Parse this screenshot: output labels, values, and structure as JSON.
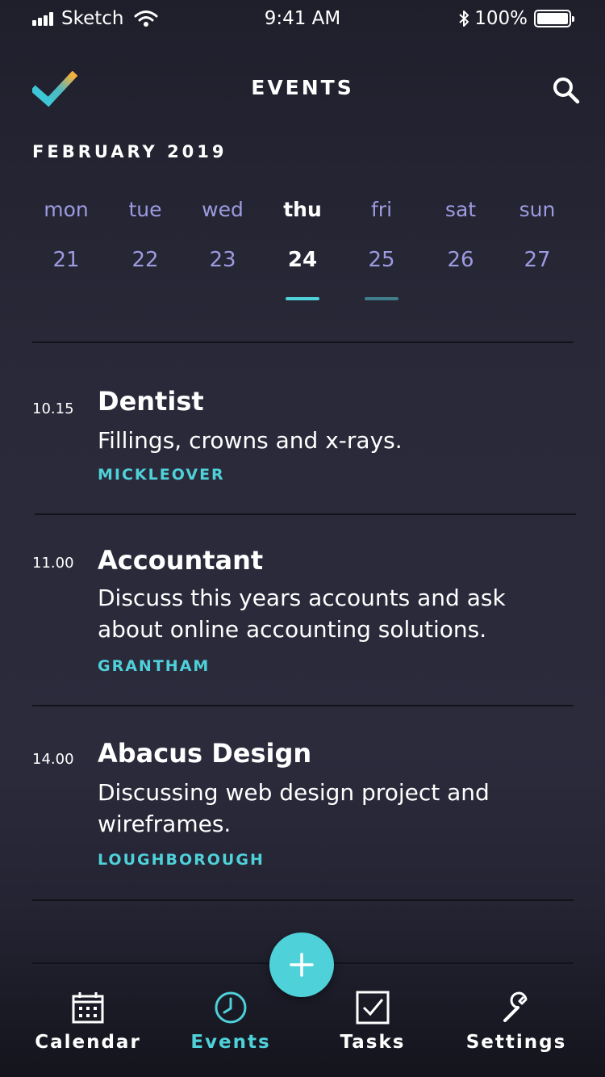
{
  "status_bar": {
    "carrier": "Sketch",
    "time": "9:41 AM",
    "battery": "100%"
  },
  "header": {
    "title": "EVENTS",
    "logo_icon": "checkmark-logo-icon",
    "search_icon": "search-icon"
  },
  "calendar": {
    "month": "FEBRUARY 2019",
    "days": [
      {
        "name": "mon",
        "num": "21"
      },
      {
        "name": "tue",
        "num": "22"
      },
      {
        "name": "wed",
        "num": "23"
      },
      {
        "name": "thu",
        "num": "24"
      },
      {
        "name": "fri",
        "num": "25"
      },
      {
        "name": "sat",
        "num": "26"
      },
      {
        "name": "sun",
        "num": "27"
      }
    ],
    "selected_day": "thu",
    "accent_color": "#4fd1d9"
  },
  "events": [
    {
      "time": "10.15",
      "title": "Dentist",
      "description": "Fillings, crowns and x-rays.",
      "location": "MICKLEOVER"
    },
    {
      "time": "11.00",
      "title": "Accountant",
      "description": "Discuss this years accounts and ask about online accounting solutions.",
      "location": "GRANTHAM"
    },
    {
      "time": "14.00",
      "title": "Abacus Design",
      "description": "Discussing web design project and wireframes.",
      "location": "LOUGHBOROUGH"
    }
  ],
  "fab": {
    "icon": "plus-icon"
  },
  "tabbar": {
    "items": [
      {
        "label": "Calendar",
        "icon": "calendar-icon"
      },
      {
        "label": "Events",
        "icon": "clock-icon"
      },
      {
        "label": "Tasks",
        "icon": "checkbox-icon"
      },
      {
        "label": "Settings",
        "icon": "wrench-icon"
      }
    ],
    "active": "Events"
  }
}
